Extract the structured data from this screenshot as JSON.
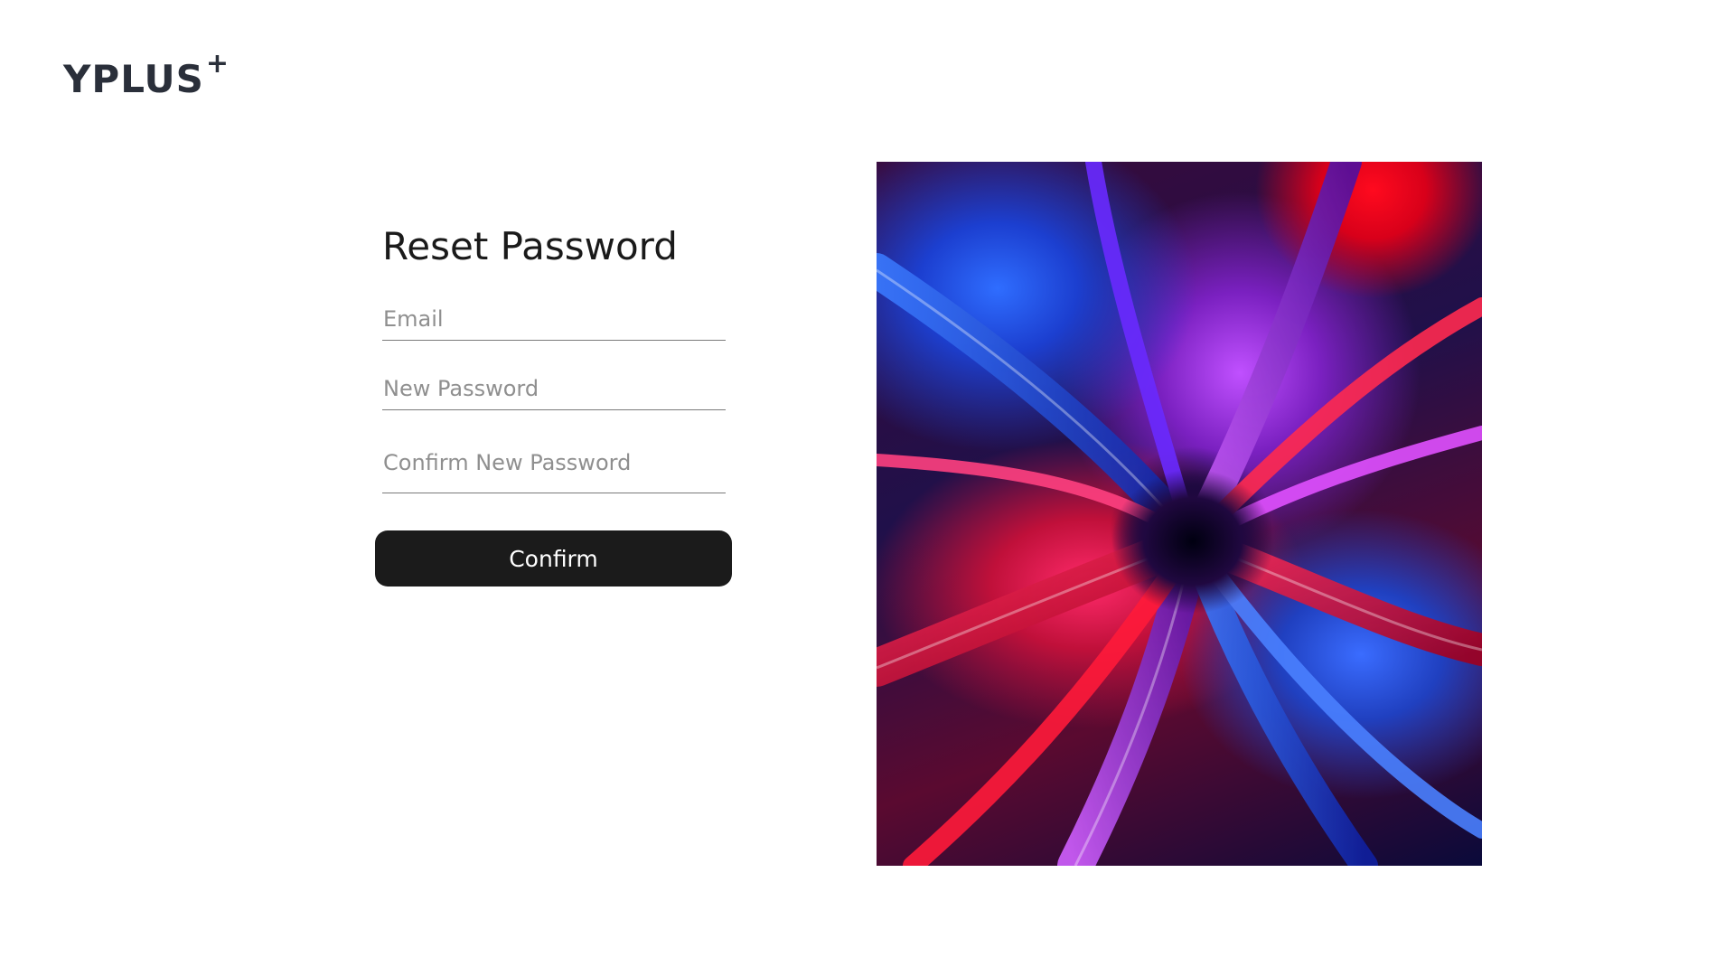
{
  "logo": {
    "text": "YPLUS",
    "plus": "+"
  },
  "form": {
    "title": "Reset Password",
    "email": {
      "placeholder": "Email",
      "value": ""
    },
    "new_password": {
      "placeholder": "New Password",
      "value": ""
    },
    "confirm_password": {
      "placeholder": "Confirm New Password",
      "value": ""
    },
    "confirm_label": "Confirm"
  },
  "artwork": {
    "icon": "abstract-artwork-image",
    "colors": [
      "#ff0a1e",
      "#2f6dff",
      "#c050ff",
      "#ff2a6a",
      "#1a0a40"
    ]
  }
}
